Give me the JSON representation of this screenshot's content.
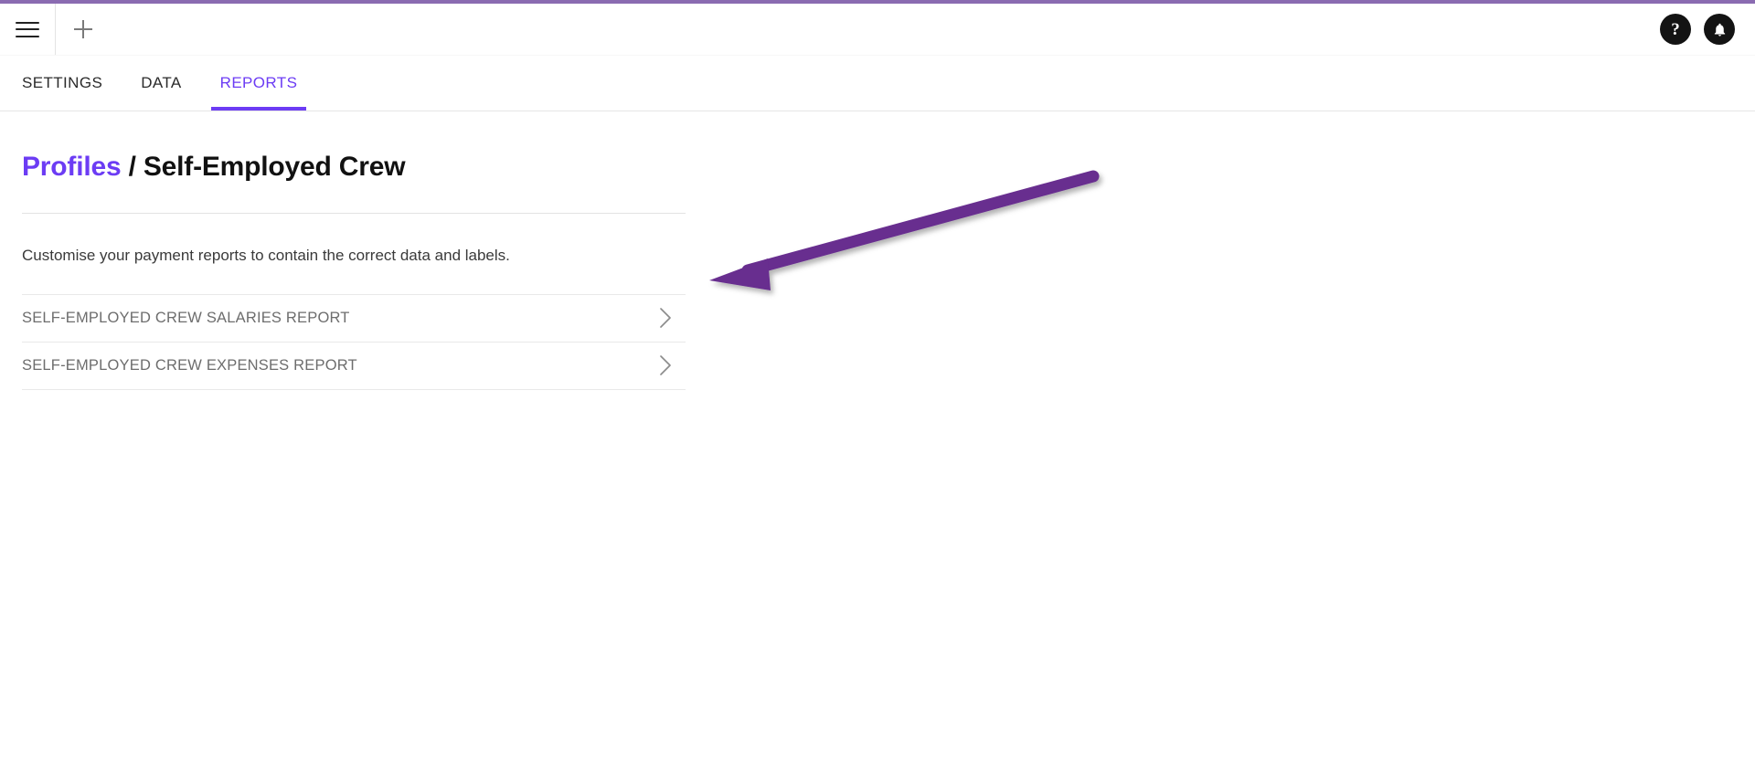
{
  "app_bar": {
    "menu_icon": "hamburger-menu-icon",
    "add_icon": "plus-icon",
    "help_label": "?",
    "help_icon": "help-circle-icon",
    "notifications_icon": "bell-icon"
  },
  "tabs": [
    {
      "label": "SETTINGS",
      "active": false
    },
    {
      "label": "DATA",
      "active": false
    },
    {
      "label": "REPORTS",
      "active": true
    }
  ],
  "breadcrumb": {
    "parent": "Profiles",
    "separator": "/",
    "current": "Self-Employed Crew"
  },
  "description": "Customise your payment reports to contain the correct data and labels.",
  "reports": [
    {
      "label": "SELF-EMPLOYED CREW SALARIES REPORT",
      "chevron": "chevron-right-icon"
    },
    {
      "label": "SELF-EMPLOYED CREW EXPENSES REPORT",
      "chevron": "chevron-right-icon"
    }
  ],
  "annotation": {
    "type": "arrow",
    "color": "#672d8f",
    "points_to": "SELF-EMPLOYED CREW SALARIES REPORT"
  },
  "colors": {
    "accent_purple": "#6c3cf4",
    "top_strip_purple": "#8a6bb1",
    "annotation_purple": "#672d8f",
    "icon_dark": "#131313",
    "muted_text": "#6d6d6d",
    "divider": "#e9e9e9"
  }
}
